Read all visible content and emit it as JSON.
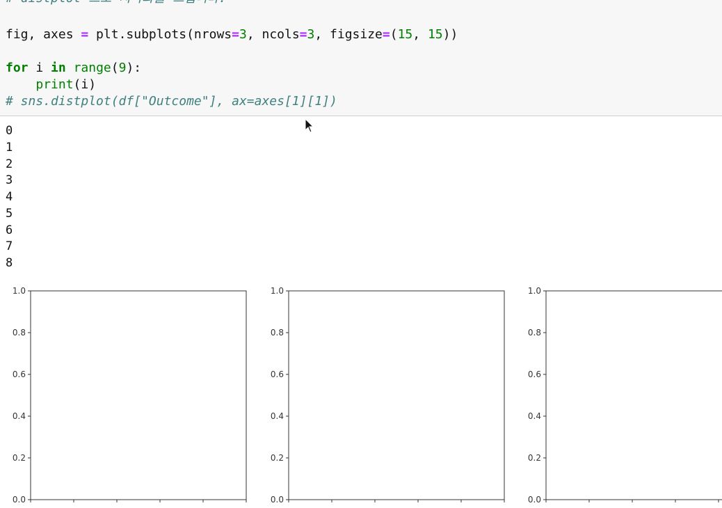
{
  "code_cell": {
    "lines": [
      {
        "tokens": [
          {
            "t": "# distplot 으로 시각화를 그립니다.",
            "c": "cm"
          }
        ]
      },
      {
        "tokens": [
          {
            "t": "fig, axes ",
            "c": ""
          },
          {
            "t": "=",
            "c": "op"
          },
          {
            "t": " plt.subplots(nrows",
            "c": ""
          },
          {
            "t": "=",
            "c": "op"
          },
          {
            "t": "3",
            "c": "num"
          },
          {
            "t": ", ncols",
            "c": ""
          },
          {
            "t": "=",
            "c": "op"
          },
          {
            "t": "3",
            "c": "num"
          },
          {
            "t": ", figsize",
            "c": ""
          },
          {
            "t": "=",
            "c": "op"
          },
          {
            "t": "(",
            "c": ""
          },
          {
            "t": "15",
            "c": "num"
          },
          {
            "t": ", ",
            "c": ""
          },
          {
            "t": "15",
            "c": "num"
          },
          {
            "t": "))",
            "c": ""
          }
        ]
      },
      {
        "tokens": [
          {
            "t": "for",
            "c": "kw"
          },
          {
            "t": " i ",
            "c": ""
          },
          {
            "t": "in",
            "c": "kw"
          },
          {
            "t": " ",
            "c": ""
          },
          {
            "t": "range",
            "c": "bi"
          },
          {
            "t": "(",
            "c": ""
          },
          {
            "t": "9",
            "c": "num"
          },
          {
            "t": "):",
            "c": ""
          }
        ]
      },
      {
        "tokens": [
          {
            "t": "    ",
            "c": ""
          },
          {
            "t": "print",
            "c": "bi"
          },
          {
            "t": "(i)",
            "c": ""
          }
        ]
      },
      {
        "tokens": [
          {
            "t": "# sns.distplot(df[\"Outcome\"], ax=axes[1][1])",
            "c": "cm"
          }
        ]
      }
    ]
  },
  "output": {
    "lines": [
      "0",
      "1",
      "2",
      "3",
      "4",
      "5",
      "6",
      "7",
      "8"
    ]
  },
  "chart_data": [
    {
      "type": "scatter",
      "series": [],
      "ylim": [
        0.0,
        1.0
      ],
      "xlim": [
        0.0,
        1.0
      ],
      "yticks": [
        "0.0",
        "0.2",
        "0.4",
        "0.6",
        "0.8",
        "1.0"
      ],
      "grid": false
    },
    {
      "type": "scatter",
      "series": [],
      "ylim": [
        0.0,
        1.0
      ],
      "xlim": [
        0.0,
        1.0
      ],
      "yticks": [
        "0.0",
        "0.2",
        "0.4",
        "0.6",
        "0.8",
        "1.0"
      ],
      "grid": false
    },
    {
      "type": "scatter",
      "series": [],
      "ylim": [
        0.0,
        1.0
      ],
      "xlim": [
        0.0,
        1.0
      ],
      "yticks": [
        "0.0",
        "0.2",
        "0.4",
        "0.6",
        "0.8",
        "1.0"
      ],
      "grid": false
    }
  ],
  "icons": {
    "cursor": "mouse-pointer-icon"
  }
}
